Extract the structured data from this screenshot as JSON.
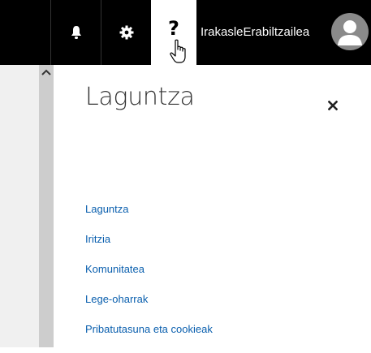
{
  "topbar": {
    "icons": {
      "bell": "bell-icon",
      "gear": "gear-icon",
      "help": "help-icon",
      "help_glyph": "?",
      "avatar": "user-avatar-icon"
    },
    "username": "IrakasleErabiltzailea"
  },
  "panel": {
    "title": "Laguntza",
    "close_glyph": "×",
    "links": [
      {
        "label": "Laguntza"
      },
      {
        "label": "Iritzia"
      },
      {
        "label": "Komunitatea"
      },
      {
        "label": "Lege-oharrak"
      },
      {
        "label": "Pribatutasuna eta cookieak"
      }
    ]
  },
  "colors": {
    "topbar_bg": "#000000",
    "link": "#0a5fae",
    "title": "#333333",
    "avatar_bg": "#8a8a8a"
  }
}
